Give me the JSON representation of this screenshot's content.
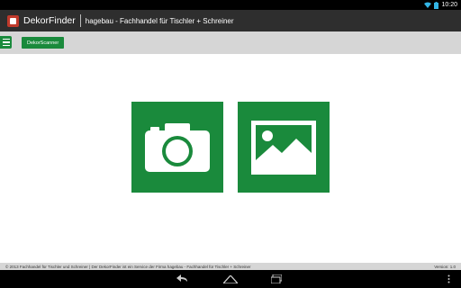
{
  "status_bar": {
    "time": "10:20"
  },
  "app_bar": {
    "title": "DekorFinder",
    "subtitle": "hagebau - Fachhandel für Tischler + Schreiner"
  },
  "toolbar": {
    "scanner_label": "DekorScanner"
  },
  "tiles": [
    {
      "icon": "camera-icon"
    },
    {
      "icon": "image-gallery-icon"
    }
  ],
  "footer": {
    "copyright": "© 2013 Fachhandel für Tischler und Schreiner | Der DekorFinder ist ein Service der Firma hagebau - Fachhandel für Tischler + Schreiner",
    "version": "Version: 1.0"
  },
  "colors": {
    "brand_green": "#1a8a3c",
    "app_bar": "#2e2e2e",
    "toolbar": "#d6d6d6"
  }
}
